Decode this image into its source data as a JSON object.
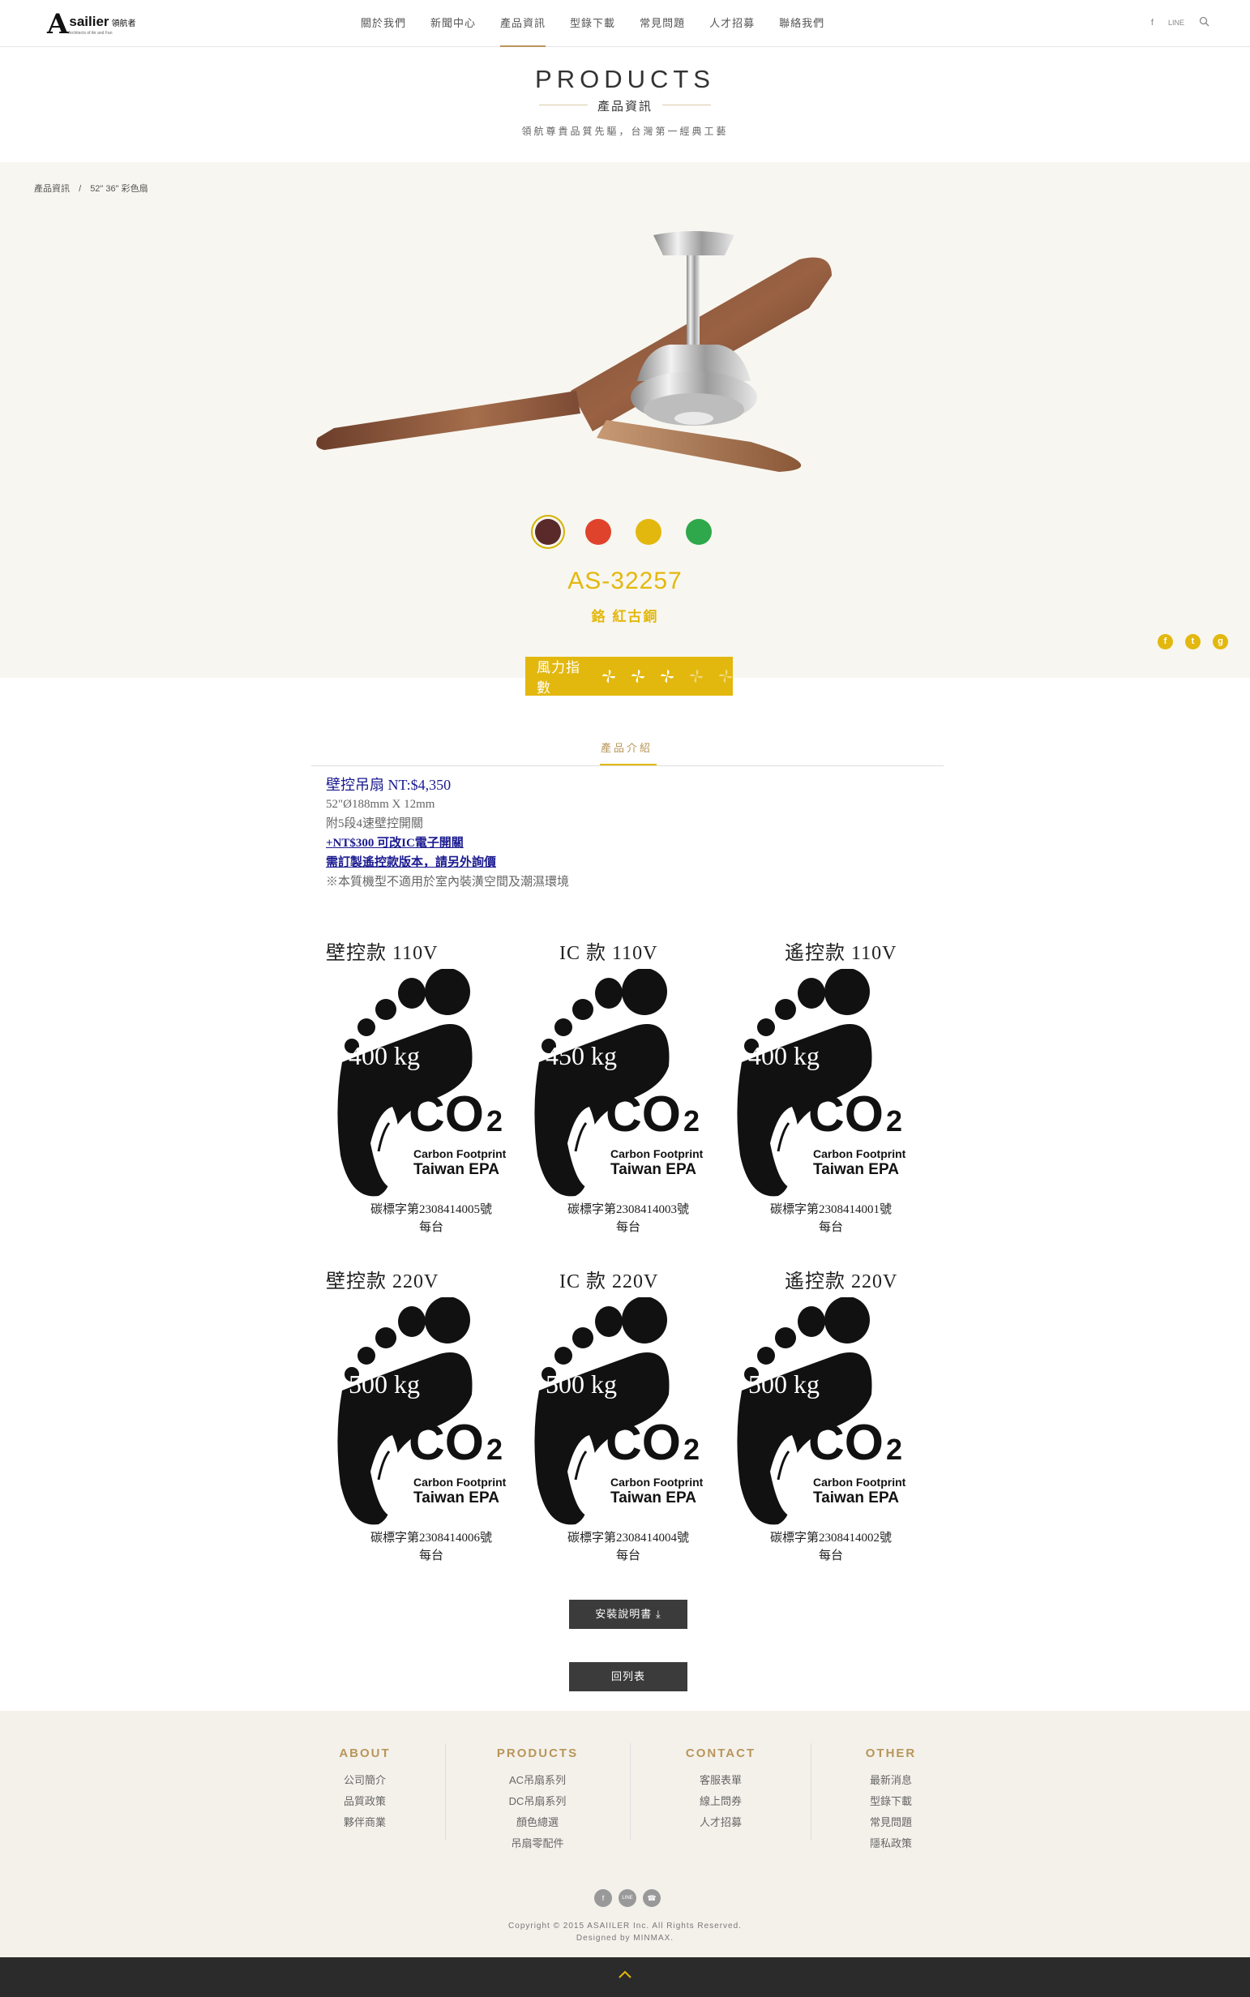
{
  "header": {
    "logo_text": "sailier",
    "logo_sub": "領航者",
    "logo_tag": "Architects of Air and Fan",
    "nav": [
      {
        "label": "關於我們"
      },
      {
        "label": "新聞中心"
      },
      {
        "label": "產品資訊"
      },
      {
        "label": "型錄下載"
      },
      {
        "label": "常見問題"
      },
      {
        "label": "人才招募"
      },
      {
        "label": "聯絡我們"
      }
    ],
    "icons": {
      "facebook": "f",
      "line": "LINE",
      "search": "search-icon"
    }
  },
  "title": {
    "en": "PRODUCTS",
    "zh": "產品資訊",
    "sub": "領航尊貴品質先驅，台灣第一經典工藝"
  },
  "breadcrumb": {
    "root": "產品資訊",
    "sep": "/",
    "current": "52\" 36\" 彩色扇"
  },
  "product": {
    "model": "AS-32257",
    "color_name": "鉻 紅古銅",
    "swatches": [
      "#5a2a2a",
      "#e0432c",
      "#e3b80e",
      "#2ea84a"
    ],
    "selected_swatch": 0,
    "wind_label": "風力指數",
    "wind_level": 3,
    "wind_max": 5
  },
  "share": {
    "facebook": "f",
    "twitter": "t",
    "google": "g"
  },
  "tab": {
    "label": "產品介紹"
  },
  "description": {
    "price_line": "壁控吊扇 NT:$4,350",
    "size_line": "52\"Ø188mm X 12mm",
    "switch_line": "附5段4速壁控開關",
    "ic_line": "+NT$300 可改IC電子開關",
    "remote_line": "需訂製遙控款版本，請另外詢價",
    "note_line": "※本質機型不適用於室內裝潢空間及潮濕環境"
  },
  "certs": [
    {
      "label": "壁控款 110V",
      "weight": "400 kg",
      "code": "碳標字第2308414005號",
      "unit": "每台"
    },
    {
      "label": "IC 款 110V",
      "weight": "450 kg",
      "code": "碳標字第2308414003號",
      "unit": "每台"
    },
    {
      "label": "遙控款 110V",
      "weight": "400 kg",
      "code": "碳標字第2308414001號",
      "unit": "每台"
    },
    {
      "label": "壁控款 220V",
      "weight": "500 kg",
      "code": "碳標字第2308414006號",
      "unit": "每台"
    },
    {
      "label": "IC 款 220V",
      "weight": "500 kg",
      "code": "碳標字第2308414004號",
      "unit": "每台"
    },
    {
      "label": "遙控款 220V",
      "weight": "500 kg",
      "code": "碳標字第2308414002號",
      "unit": "每台"
    }
  ],
  "cert_text": {
    "co2": "CO",
    "sub": "2",
    "cf": "Carbon Footprint",
    "epa": "Taiwan EPA"
  },
  "buttons": {
    "manual": "安裝說明書",
    "back": "回列表"
  },
  "footer": {
    "columns": [
      {
        "title": "ABOUT",
        "items": [
          "公司簡介",
          "品質政策",
          "夥伴商業"
        ]
      },
      {
        "title": "PRODUCTS",
        "items": [
          "AC吊扇系列",
          "DC吊扇系列",
          "顏色總選",
          "吊扇零配件"
        ]
      },
      {
        "title": "CONTACT",
        "items": [
          "客服表單",
          "線上問券",
          "人才招募"
        ]
      },
      {
        "title": "OTHER",
        "items": [
          "最新消息",
          "型錄下載",
          "常見問題",
          "隱私政策"
        ]
      }
    ],
    "icons": {
      "facebook": "f",
      "line": "LINE",
      "phone": "☎"
    },
    "copyright": "Copyright © 2015 ASAIILER Inc. All Rights Reserved.",
    "designed": "Designed by MINMAX."
  }
}
